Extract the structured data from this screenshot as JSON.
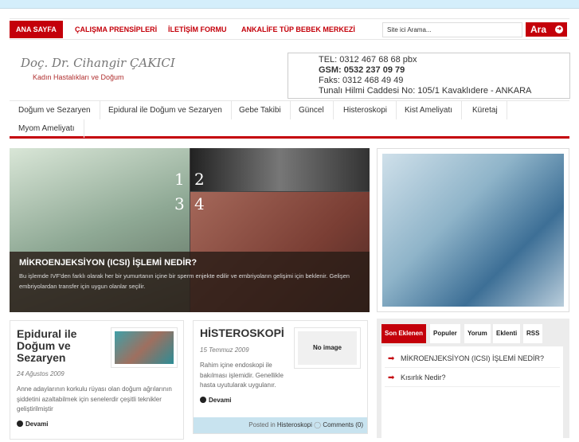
{
  "top_nav": [
    "ANA SAYFA",
    "ÇALIŞMA PRENSİPLERİ",
    "İLETİŞİM FORMU",
    "ANKALİFE TÜP BEBEK MERKEZİ"
  ],
  "search": {
    "placeholder": "Site ici Arama...",
    "button": "Ara"
  },
  "logo": {
    "name": "Doç. Dr. Cihangir ÇAKICI",
    "subtitle": "Kadın Hastalıkları ve Doğum"
  },
  "contact": [
    "TEL:  0312 467 68 68 pbx",
    "GSM: 0532 237 09 79",
    "Faks: 0312 468 49 49",
    "Tunalı Hilmi Caddesi No: 105/1 Kavaklıdere - ANKARA"
  ],
  "main_nav": [
    "Doğum ve Sezaryen",
    "Epidural ile Doğum ve Sezaryen",
    "Gebe Takibi",
    "Güncel",
    "Histeroskopi",
    "Kist Ameliyatı",
    "Küretaj",
    "Myom Ameliyatı"
  ],
  "slider": {
    "numbers": [
      "1",
      "2",
      "3",
      "4"
    ],
    "title": "MİKROENJEKSİYON (ICSI) İŞLEMİ NEDİR?",
    "text": "Bu işlemde IVF'den farklı olarak her bir yumurtanın içine bir sperm enjekte edilir ve embriyoların gelişimi için beklenir. Gelişen embriyolardan transfer için uygun olanlar seçilir."
  },
  "posts": [
    {
      "title": "Epidural ile Doğum ve Sezaryen",
      "date": "24 Ağustos 2009",
      "excerpt": "Anne adaylarının korkulu rüyası olan doğum ağrılarının şiddetini azaltabilmek için senelerdir çeşitli teknikler geliştirilmiştir",
      "more": "Devami"
    },
    {
      "title": "HİSTEROSKOPİ",
      "date": "15 Temmuz 2009",
      "excerpt": "Rahim içine endoskopi ile bakılması işlemidir. Genellikle hasta uyutularak uygulanır.",
      "more": "Devami",
      "no_image": "No image",
      "posted_in": "Posted in",
      "category": "Histeroskopi",
      "comments": "Comments (0)"
    }
  ],
  "sidebar_tabs": [
    "Son Eklenen",
    "Populer",
    "Yorum",
    "Eklenti",
    "RSS"
  ],
  "recent": [
    "MİKROENJEKSİYON (ICSI) İŞLEMİ NEDİR?",
    "Kısırlık Nedir?"
  ],
  "colors": {
    "accent": "#c4000a",
    "footer": "#c8e3ef"
  }
}
